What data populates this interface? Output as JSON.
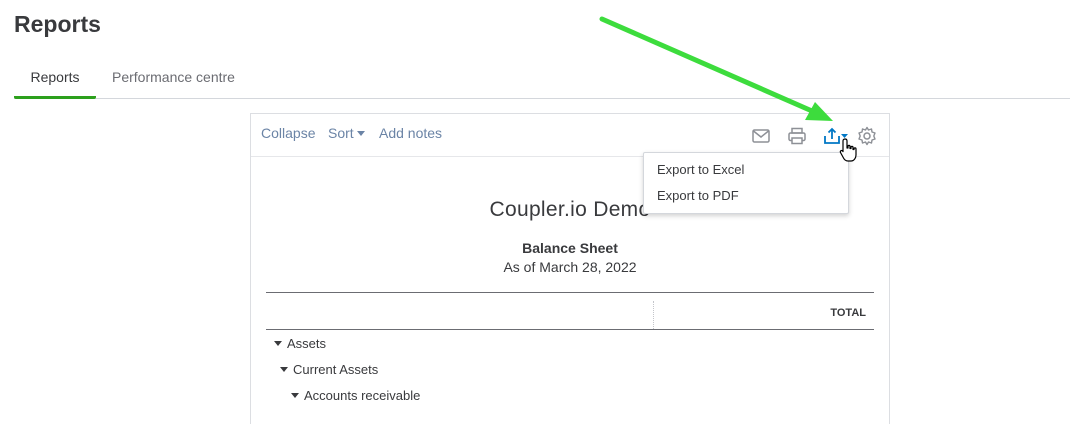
{
  "page": {
    "title": "Reports"
  },
  "tabs": [
    {
      "label": "Reports",
      "active": true
    },
    {
      "label": "Performance centre",
      "active": false
    }
  ],
  "toolbar": {
    "collapse": "Collapse",
    "sort": "Sort",
    "add_notes": "Add notes",
    "icons": [
      "mail-icon",
      "print-icon",
      "export-icon",
      "gear-icon"
    ]
  },
  "export_menu": {
    "items": [
      "Export to Excel",
      "Export to PDF"
    ]
  },
  "report": {
    "company": "Coupler.io Demo",
    "title": "Balance Sheet",
    "date": "As of March 28, 2022",
    "column_header": "TOTAL",
    "rows": [
      "Assets",
      "Current Assets",
      "Accounts receivable"
    ]
  },
  "colors": {
    "accent_green": "#2ca01c",
    "link_blue": "#6b84a6",
    "export_blue": "#0077c5",
    "annotation_arrow": "#3ddc3d"
  }
}
